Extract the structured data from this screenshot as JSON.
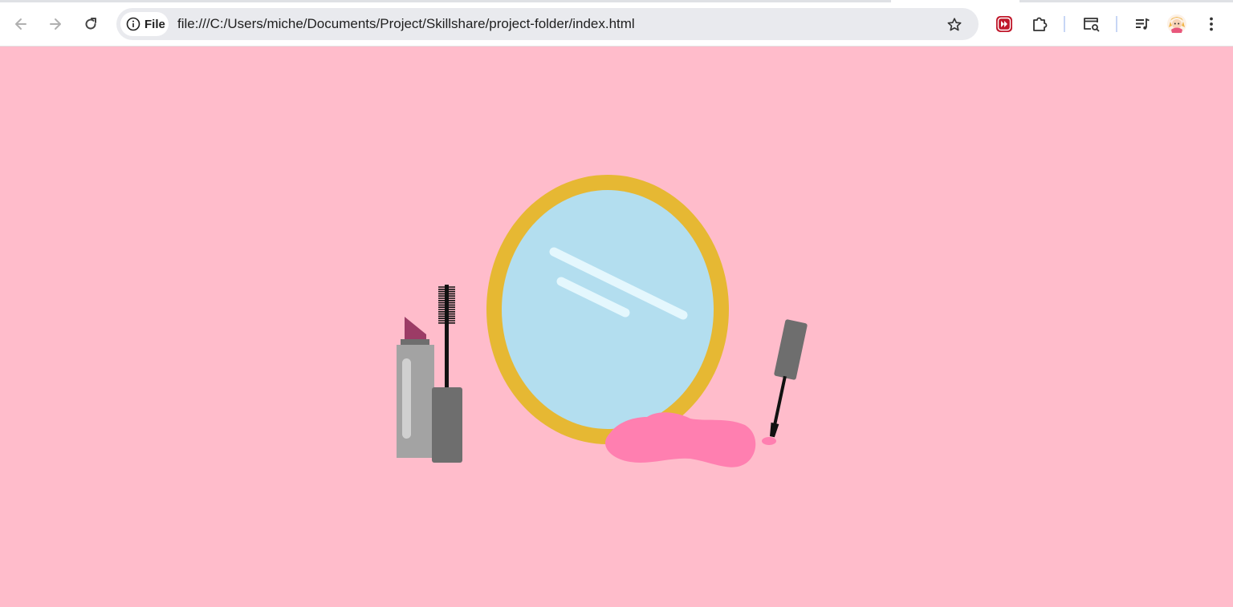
{
  "browser": {
    "site_chip_label": "File",
    "url": "file:///C:/Users/miche/Documents/Project/Skillshare/project-folder/index.html",
    "icons": {
      "back": "arrow-left-icon",
      "forward": "arrow-right-icon",
      "reload": "reload-icon",
      "site_info": "info-icon",
      "bookmark": "star-icon",
      "extension_1": "fast-forward-extension-icon",
      "extensions": "puzzle-piece-icon",
      "search_tab": "search-tab-icon",
      "media": "media-queue-icon",
      "profile": "profile-avatar-icon",
      "menu": "kebab-menu-icon"
    }
  },
  "page": {
    "background": "#ffbccb",
    "colors": {
      "mirror_frame": "#e6b833",
      "mirror_glass": "#b3deef",
      "mirror_shine": "#e4f7fd",
      "lipstick_tip": "#9c3c66",
      "lipstick_body": "#a3a3a3",
      "mascara_cap": "#6e6e6e",
      "nail_polish_spill": "#ff7fb0"
    }
  }
}
